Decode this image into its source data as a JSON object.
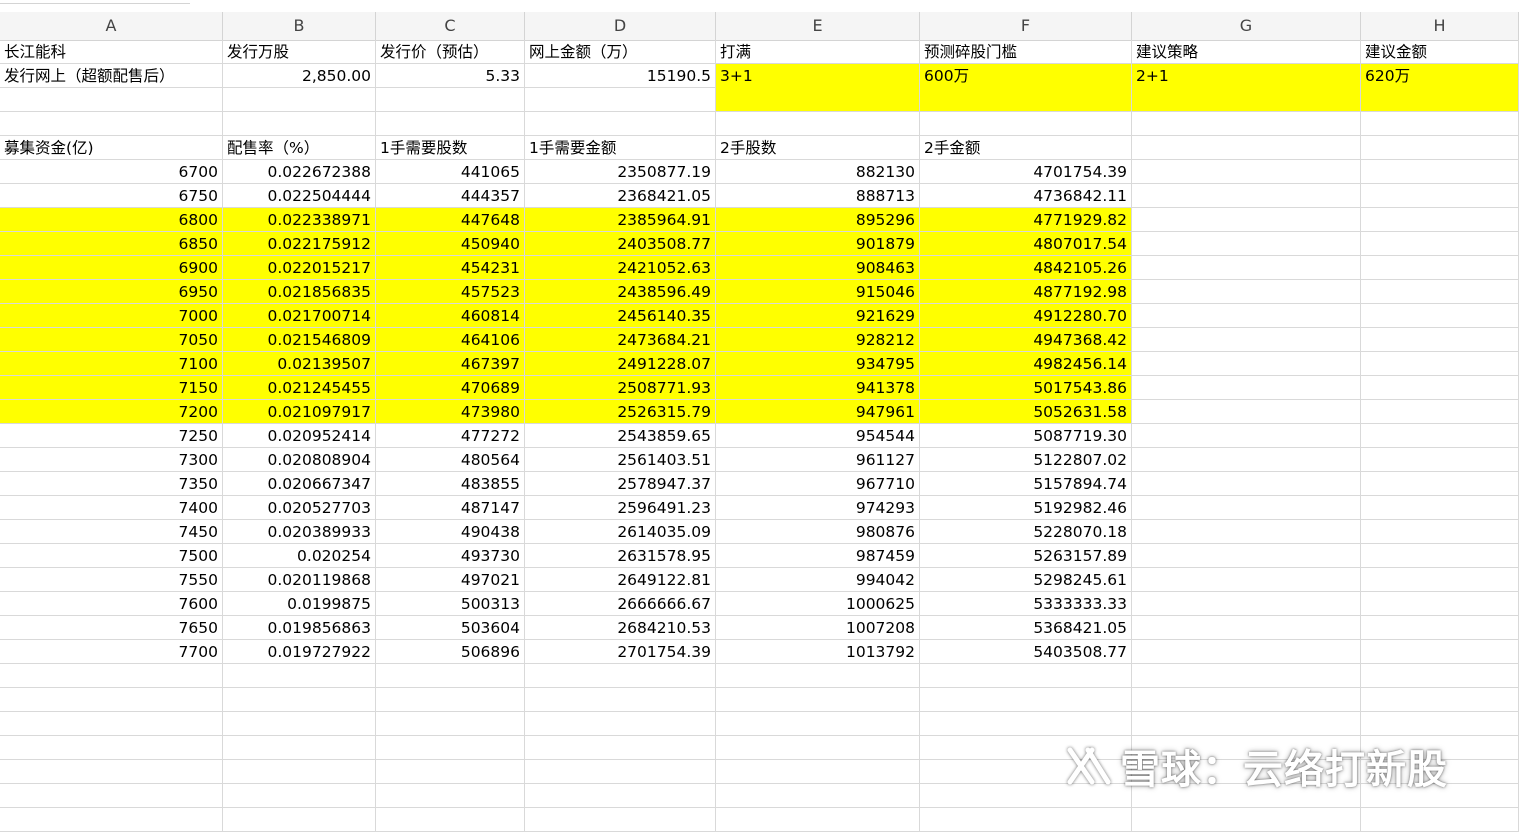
{
  "columns": [
    "A",
    "B",
    "C",
    "D",
    "E",
    "F",
    "G",
    "H"
  ],
  "row1": [
    "长江能科",
    "发行万股",
    "发行价（预估）",
    "网上金额（万）",
    "打满",
    "预测碎股门槛",
    "建议策略",
    "建议金额"
  ],
  "row2": [
    "发行网上（超额配售后）",
    "2,850.00",
    "5.33",
    "15190.5",
    "3+1",
    "600万",
    "2+1",
    "620万"
  ],
  "header2": [
    "募集资金(亿)",
    "配售率（%）",
    "1手需要股数",
    "1手需要金额",
    "2手股数",
    "2手金额"
  ],
  "rows": [
    [
      "6700",
      "0.022672388",
      "441065",
      "2350877.19",
      "882130",
      "4701754.39"
    ],
    [
      "6750",
      "0.022504444",
      "444357",
      "2368421.05",
      "888713",
      "4736842.11"
    ],
    [
      "6800",
      "0.022338971",
      "447648",
      "2385964.91",
      "895296",
      "4771929.82"
    ],
    [
      "6850",
      "0.022175912",
      "450940",
      "2403508.77",
      "901879",
      "4807017.54"
    ],
    [
      "6900",
      "0.022015217",
      "454231",
      "2421052.63",
      "908463",
      "4842105.26"
    ],
    [
      "6950",
      "0.021856835",
      "457523",
      "2438596.49",
      "915046",
      "4877192.98"
    ],
    [
      "7000",
      "0.021700714",
      "460814",
      "2456140.35",
      "921629",
      "4912280.70"
    ],
    [
      "7050",
      "0.021546809",
      "464106",
      "2473684.21",
      "928212",
      "4947368.42"
    ],
    [
      "7100",
      "0.02139507",
      "467397",
      "2491228.07",
      "934795",
      "4982456.14"
    ],
    [
      "7150",
      "0.021245455",
      "470689",
      "2508771.93",
      "941378",
      "5017543.86"
    ],
    [
      "7200",
      "0.021097917",
      "473980",
      "2526315.79",
      "947961",
      "5052631.58"
    ],
    [
      "7250",
      "0.020952414",
      "477272",
      "2543859.65",
      "954544",
      "5087719.30"
    ],
    [
      "7300",
      "0.020808904",
      "480564",
      "2561403.51",
      "961127",
      "5122807.02"
    ],
    [
      "7350",
      "0.020667347",
      "483855",
      "2578947.37",
      "967710",
      "5157894.74"
    ],
    [
      "7400",
      "0.020527703",
      "487147",
      "2596491.23",
      "974293",
      "5192982.46"
    ],
    [
      "7450",
      "0.020389933",
      "490438",
      "2614035.09",
      "980876",
      "5228070.18"
    ],
    [
      "7500",
      "0.020254",
      "493730",
      "2631578.95",
      "987459",
      "5263157.89"
    ],
    [
      "7550",
      "0.020119868",
      "497021",
      "2649122.81",
      "994042",
      "5298245.61"
    ],
    [
      "7600",
      "0.0199875",
      "500313",
      "2666666.67",
      "1000625",
      "5333333.33"
    ],
    [
      "7650",
      "0.019856863",
      "503604",
      "2684210.53",
      "1007208",
      "5368421.05"
    ],
    [
      "7700",
      "0.019727922",
      "506896",
      "2701754.39",
      "1013792",
      "5403508.77"
    ]
  ],
  "highlight_from_value": "6800",
  "highlight_to_value": "7200",
  "highlight_color": "#ffff00",
  "watermark": "雪球：云络打新股",
  "watermark_icon": "xueqiu-logo-icon"
}
